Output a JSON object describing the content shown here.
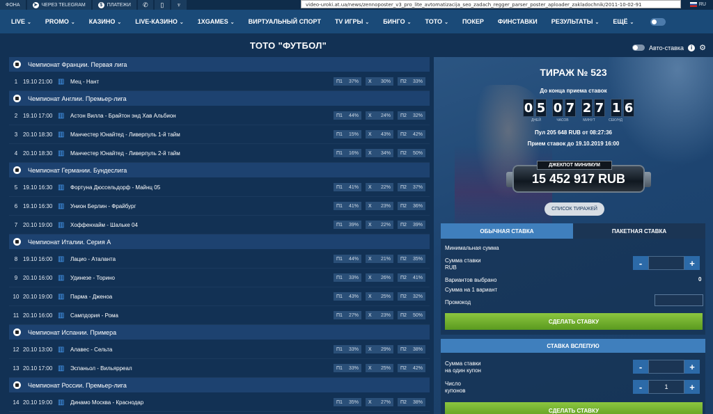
{
  "topbar": {
    "items": [
      "ФОНА",
      "ЧЕРЕЗ TELEGRAM",
      "ПЛАТЕЖИ"
    ],
    "url": "video-uroki.at.ua/news/zennoposter_v3_pro_lite_avtomatizacija_seo_zadach_regger_parser_poster_aploader_zakladochnik/2011-10-02-91",
    "lang": "RU"
  },
  "nav": {
    "items": [
      {
        "label": "LIVE",
        "chev": true
      },
      {
        "label": "PROMO",
        "chev": true
      },
      {
        "label": "КАЗИНО",
        "chev": true
      },
      {
        "label": "LIVE-КАЗИНО",
        "chev": true
      },
      {
        "label": "1XGAMES",
        "chev": true
      },
      {
        "label": "ВИРТУАЛЬНЫЙ СПОРТ",
        "chev": false
      },
      {
        "label": "TV ИГРЫ",
        "chev": true
      },
      {
        "label": "БИНГО",
        "chev": true
      },
      {
        "label": "ТОТО",
        "chev": true
      },
      {
        "label": "ПОКЕР",
        "chev": false
      },
      {
        "label": "ФИНСТАВКИ",
        "chev": false
      },
      {
        "label": "РЕЗУЛЬТАТЫ",
        "chev": true
      },
      {
        "label": "ЕЩЁ",
        "chev": true
      }
    ]
  },
  "page": {
    "title": "ТОТО \"ФУТБОЛ\"",
    "auto_bet": "Авто-ставка"
  },
  "leagues": [
    {
      "name": "Чемпионат Франции. Первая лига",
      "matches": [
        {
          "num": "1",
          "date": "19.10 21:00",
          "name": "Мец - Нант",
          "p1": "37%",
          "x": "30%",
          "p2": "33%"
        }
      ]
    },
    {
      "name": "Чемпионат Англии. Премьер-лига",
      "matches": [
        {
          "num": "2",
          "date": "19.10 17:00",
          "name": "Астон Вилла - Брайтон энд Хав Альбион",
          "p1": "44%",
          "x": "24%",
          "p2": "32%"
        },
        {
          "num": "3",
          "date": "20.10 18:30",
          "name": "Манчестер Юнайтед - Ливерпуль 1-й тайм",
          "p1": "15%",
          "x": "43%",
          "p2": "42%"
        },
        {
          "num": "4",
          "date": "20.10 18:30",
          "name": "Манчестер Юнайтед - Ливерпуль 2-й тайм",
          "p1": "16%",
          "x": "34%",
          "p2": "50%"
        }
      ]
    },
    {
      "name": "Чемпионат Германии. Бундеслига",
      "matches": [
        {
          "num": "5",
          "date": "19.10 16:30",
          "name": "Фортуна Дюссельдорф - Майнц 05",
          "p1": "41%",
          "x": "22%",
          "p2": "37%"
        },
        {
          "num": "6",
          "date": "19.10 16:30",
          "name": "Унион Берлин - Фрайбург",
          "p1": "41%",
          "x": "23%",
          "p2": "36%"
        },
        {
          "num": "7",
          "date": "20.10 19:00",
          "name": "Хоффенхайм - Шальке 04",
          "p1": "39%",
          "x": "22%",
          "p2": "39%"
        }
      ]
    },
    {
      "name": "Чемпионат Италии. Серия А",
      "matches": [
        {
          "num": "8",
          "date": "19.10 16:00",
          "name": "Лацио - Аталанта",
          "p1": "44%",
          "x": "21%",
          "p2": "35%"
        },
        {
          "num": "9",
          "date": "20.10 16:00",
          "name": "Удинезе - Торино",
          "p1": "33%",
          "x": "26%",
          "p2": "41%"
        },
        {
          "num": "10",
          "date": "20.10 19:00",
          "name": "Парма - Дженоа",
          "p1": "43%",
          "x": "25%",
          "p2": "32%"
        },
        {
          "num": "11",
          "date": "20.10 16:00",
          "name": "Сампдория - Рома",
          "p1": "27%",
          "x": "23%",
          "p2": "50%"
        }
      ]
    },
    {
      "name": "Чемпионат Испании. Примера",
      "matches": [
        {
          "num": "12",
          "date": "20.10 13:00",
          "name": "Алавес - Сельта",
          "p1": "33%",
          "x": "29%",
          "p2": "38%"
        },
        {
          "num": "13",
          "date": "20.10 17:00",
          "name": "Эспаньол - Вильярреал",
          "p1": "33%",
          "x": "25%",
          "p2": "42%"
        }
      ]
    },
    {
      "name": "Чемпионат России. Премьер-лига",
      "matches": [
        {
          "num": "14",
          "date": "20.10 19:00",
          "name": "Динамо Москва - Краснодар",
          "p1": "35%",
          "x": "27%",
          "p2": "38%"
        }
      ]
    }
  ],
  "odds_labels": {
    "p1": "П1",
    "x": "X",
    "p2": "П2"
  },
  "draw": {
    "title": "ТИРАЖ № 523",
    "until": "До конца приема ставок",
    "timer": [
      "0",
      "5",
      "0",
      "7",
      "2",
      "7",
      "1",
      "6"
    ],
    "timer_labels": [
      "ДНЕЙ",
      "ЧАСОВ",
      "МИНУТ",
      "СЕКУНД"
    ],
    "pool": "Пул 205 648 RUB от 08:27:36",
    "accept": "Прием ставок до 19.10.2019 16:00",
    "jackpot_label": "ДЖЕКПОТ МИНИМУМ",
    "jackpot": "15 452 917 RUB",
    "draws_button": "СПИСОК ТИРАЖЕЙ"
  },
  "bet": {
    "tab_normal": "ОБЫЧНАЯ СТАВКА",
    "tab_package": "ПАКЕТНАЯ СТАВКА",
    "min_sum": "Минимальная сумма",
    "sum_label_1": "Сумма ставки",
    "sum_label_2": "RUB",
    "variants": "Вариантов выбрано",
    "variants_value": "0",
    "per_variant": "Сумма на 1 вариант",
    "promo": "Промокод",
    "make_bet": "СДЕЛАТЬ СТАВКУ",
    "minus": "-",
    "plus": "+"
  },
  "blind": {
    "title": "СТАВКА ВСЛЕПУЮ",
    "sum_label_1": "Сумма ставки",
    "sum_label_2": "на один купон",
    "count_label_1": "Число",
    "count_label_2": "купонов",
    "count_value": "1",
    "make_bet": "СДЕЛАТЬ СТАВКУ"
  }
}
